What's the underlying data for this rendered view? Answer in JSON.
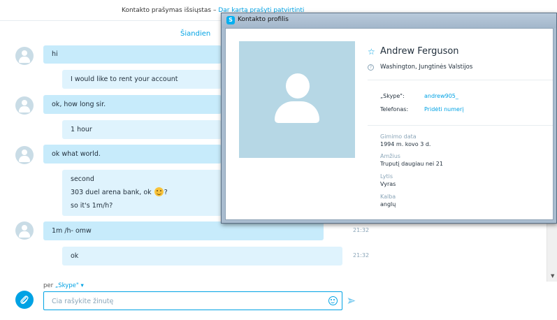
{
  "notice": {
    "text": "Kontakto prašymas išsiųstas – ",
    "link": "Dar kartą prašyti patvirtinti"
  },
  "chat": {
    "date_label": "Šiandien",
    "messages": [
      {
        "dir": "in",
        "lines": [
          "hi"
        ]
      },
      {
        "dir": "out",
        "lines": [
          "I would like to rent your account"
        ]
      },
      {
        "dir": "in",
        "lines": [
          "ok, how long sir."
        ]
      },
      {
        "dir": "out",
        "lines": [
          "1 hour"
        ]
      },
      {
        "dir": "in",
        "lines": [
          "ok what world."
        ]
      },
      {
        "dir": "out",
        "lines": [
          "second",
          "303 duel arena bank, ok",
          "so it's 1m/h?"
        ],
        "emoji_after": "?"
      },
      {
        "dir": "in",
        "lines": [
          "1m /h- omw"
        ],
        "time": "21:32"
      },
      {
        "dir": "out",
        "lines": [
          "ok"
        ],
        "time": "21:32"
      }
    ]
  },
  "composer": {
    "via_prefix": "per ",
    "via_service": "„Skype\"",
    "placeholder": "Čia rašykite žinutę"
  },
  "profile_window": {
    "title": "Kontakto profilis",
    "name": "Andrew Ferguson",
    "location": "Washington, Jungtinės Valstijos",
    "skype_label": "„Skype\":",
    "skype_value": "andrew905_",
    "phone_label": "Telefonas:",
    "phone_value": "Pridėti numerį",
    "birth_label": "Gimimo data",
    "birth_value": "1994 m. kovo 3 d.",
    "age_label": "Amžius",
    "age_value": "Truputį daugiau nei 21",
    "sex_label": "Lytis",
    "sex_value": "Vyras",
    "lang_label": "Kalba",
    "lang_value": "anglų"
  },
  "colors": {
    "accent": "#00a2e4",
    "bubble_in": "#c7ebfb",
    "bubble_out": "#dff3fd"
  }
}
